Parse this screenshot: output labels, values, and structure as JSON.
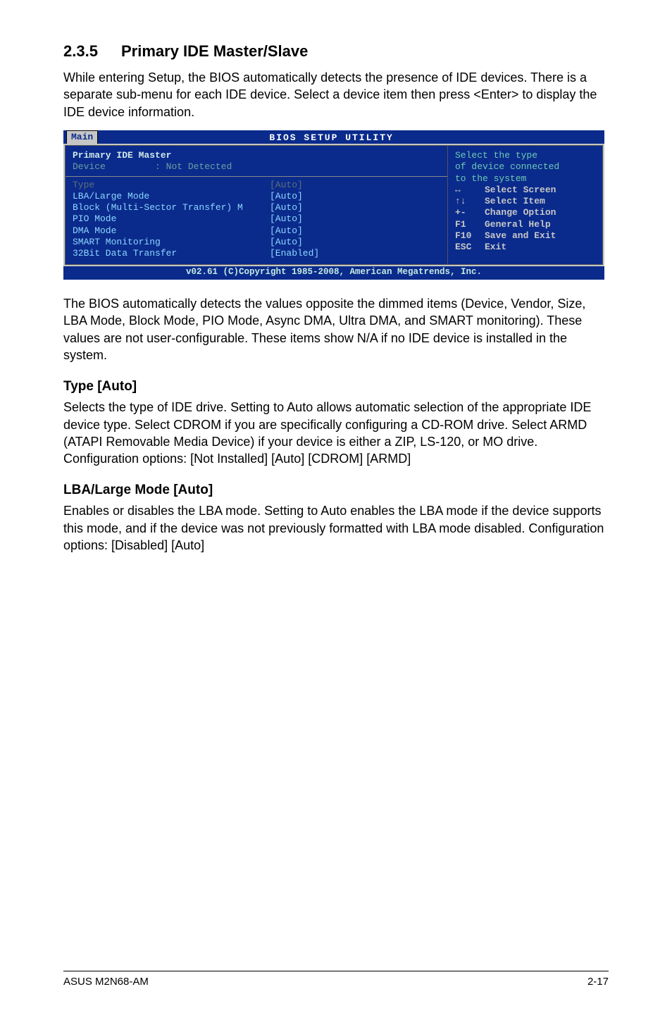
{
  "section": {
    "number": "2.3.5",
    "title": "Primary IDE Master/Slave"
  },
  "intro": "While entering Setup, the BIOS automatically detects the presence of IDE devices. There is a separate sub-menu for each IDE device. Select a device item then press <Enter> to display the IDE device information.",
  "bios": {
    "title": "BIOS SETUP UTILITY",
    "tab": "Main",
    "heading": "Primary IDE Master",
    "device_label": "Device",
    "device_sep": ":",
    "device_value": "Not Detected",
    "options": [
      {
        "label": "Type",
        "value": "[Auto]",
        "dim": true
      },
      {
        "label": "LBA/Large Mode",
        "value": "[Auto]"
      },
      {
        "label": "Block (Multi-Sector Transfer) M",
        "value": "[Auto]"
      },
      {
        "label": "PIO Mode",
        "value": "[Auto]"
      },
      {
        "label": "DMA Mode",
        "value": "[Auto]"
      },
      {
        "label": "SMART Monitoring",
        "value": "[Auto]"
      },
      {
        "label": "32Bit Data Transfer",
        "value": "[Enabled]"
      }
    ],
    "help": [
      "Select the type",
      "of device connected",
      "to the system"
    ],
    "keys": [
      {
        "k": "↔",
        "d": "Select Screen"
      },
      {
        "k": "↑↓",
        "d": "Select Item"
      },
      {
        "k": "+-",
        "d": "Change Option"
      },
      {
        "k": "F1",
        "d": "General Help"
      },
      {
        "k": "F10",
        "d": "Save and Exit"
      },
      {
        "k": "ESC",
        "d": "Exit"
      }
    ],
    "footer": "v02.61 (C)Copyright 1985-2008, American Megatrends, Inc."
  },
  "para_after_bios": "The BIOS automatically detects the values opposite the dimmed items (Device, Vendor, Size, LBA Mode, Block Mode, PIO Mode, Async DMA, Ultra DMA, and SMART monitoring). These values are not user-configurable. These items show N/A if no IDE device is installed in the system.",
  "type_heading": "Type [Auto]",
  "type_body": "Selects the type of IDE drive. Setting to Auto allows automatic selection of the appropriate IDE device type. Select CDROM if you are specifically configuring a CD-ROM drive. Select ARMD (ATAPI Removable Media Device) if your device is either a ZIP, LS-120, or MO drive. Configuration options: [Not Installed] [Auto] [CDROM] [ARMD]",
  "lba_heading": "LBA/Large Mode [Auto]",
  "lba_body": "Enables or disables the LBA mode. Setting to Auto enables the LBA mode if the device supports this mode, and if the device was not previously formatted with LBA mode disabled. Configuration options: [Disabled] [Auto]",
  "footer_left": "ASUS M2N68-AM",
  "footer_right": "2-17"
}
